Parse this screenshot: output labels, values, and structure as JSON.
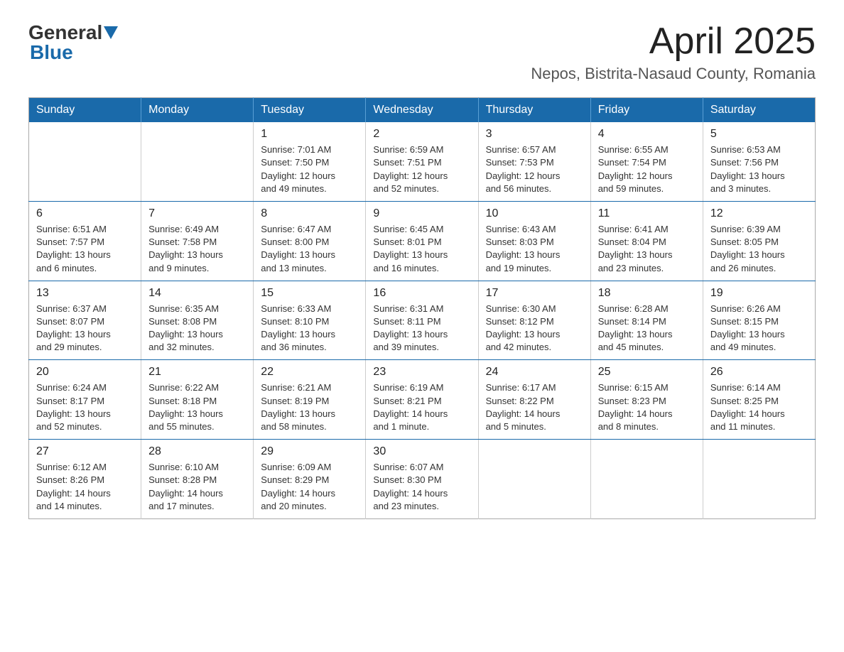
{
  "logo": {
    "general": "General",
    "blue": "Blue",
    "tagline": "Blue"
  },
  "header": {
    "month": "April 2025",
    "location": "Nepos, Bistrita-Nasaud County, Romania"
  },
  "weekdays": [
    "Sunday",
    "Monday",
    "Tuesday",
    "Wednesday",
    "Thursday",
    "Friday",
    "Saturday"
  ],
  "weeks": [
    [
      {
        "day": "",
        "info": ""
      },
      {
        "day": "",
        "info": ""
      },
      {
        "day": "1",
        "info": "Sunrise: 7:01 AM\nSunset: 7:50 PM\nDaylight: 12 hours\nand 49 minutes."
      },
      {
        "day": "2",
        "info": "Sunrise: 6:59 AM\nSunset: 7:51 PM\nDaylight: 12 hours\nand 52 minutes."
      },
      {
        "day": "3",
        "info": "Sunrise: 6:57 AM\nSunset: 7:53 PM\nDaylight: 12 hours\nand 56 minutes."
      },
      {
        "day": "4",
        "info": "Sunrise: 6:55 AM\nSunset: 7:54 PM\nDaylight: 12 hours\nand 59 minutes."
      },
      {
        "day": "5",
        "info": "Sunrise: 6:53 AM\nSunset: 7:56 PM\nDaylight: 13 hours\nand 3 minutes."
      }
    ],
    [
      {
        "day": "6",
        "info": "Sunrise: 6:51 AM\nSunset: 7:57 PM\nDaylight: 13 hours\nand 6 minutes."
      },
      {
        "day": "7",
        "info": "Sunrise: 6:49 AM\nSunset: 7:58 PM\nDaylight: 13 hours\nand 9 minutes."
      },
      {
        "day": "8",
        "info": "Sunrise: 6:47 AM\nSunset: 8:00 PM\nDaylight: 13 hours\nand 13 minutes."
      },
      {
        "day": "9",
        "info": "Sunrise: 6:45 AM\nSunset: 8:01 PM\nDaylight: 13 hours\nand 16 minutes."
      },
      {
        "day": "10",
        "info": "Sunrise: 6:43 AM\nSunset: 8:03 PM\nDaylight: 13 hours\nand 19 minutes."
      },
      {
        "day": "11",
        "info": "Sunrise: 6:41 AM\nSunset: 8:04 PM\nDaylight: 13 hours\nand 23 minutes."
      },
      {
        "day": "12",
        "info": "Sunrise: 6:39 AM\nSunset: 8:05 PM\nDaylight: 13 hours\nand 26 minutes."
      }
    ],
    [
      {
        "day": "13",
        "info": "Sunrise: 6:37 AM\nSunset: 8:07 PM\nDaylight: 13 hours\nand 29 minutes."
      },
      {
        "day": "14",
        "info": "Sunrise: 6:35 AM\nSunset: 8:08 PM\nDaylight: 13 hours\nand 32 minutes."
      },
      {
        "day": "15",
        "info": "Sunrise: 6:33 AM\nSunset: 8:10 PM\nDaylight: 13 hours\nand 36 minutes."
      },
      {
        "day": "16",
        "info": "Sunrise: 6:31 AM\nSunset: 8:11 PM\nDaylight: 13 hours\nand 39 minutes."
      },
      {
        "day": "17",
        "info": "Sunrise: 6:30 AM\nSunset: 8:12 PM\nDaylight: 13 hours\nand 42 minutes."
      },
      {
        "day": "18",
        "info": "Sunrise: 6:28 AM\nSunset: 8:14 PM\nDaylight: 13 hours\nand 45 minutes."
      },
      {
        "day": "19",
        "info": "Sunrise: 6:26 AM\nSunset: 8:15 PM\nDaylight: 13 hours\nand 49 minutes."
      }
    ],
    [
      {
        "day": "20",
        "info": "Sunrise: 6:24 AM\nSunset: 8:17 PM\nDaylight: 13 hours\nand 52 minutes."
      },
      {
        "day": "21",
        "info": "Sunrise: 6:22 AM\nSunset: 8:18 PM\nDaylight: 13 hours\nand 55 minutes."
      },
      {
        "day": "22",
        "info": "Sunrise: 6:21 AM\nSunset: 8:19 PM\nDaylight: 13 hours\nand 58 minutes."
      },
      {
        "day": "23",
        "info": "Sunrise: 6:19 AM\nSunset: 8:21 PM\nDaylight: 14 hours\nand 1 minute."
      },
      {
        "day": "24",
        "info": "Sunrise: 6:17 AM\nSunset: 8:22 PM\nDaylight: 14 hours\nand 5 minutes."
      },
      {
        "day": "25",
        "info": "Sunrise: 6:15 AM\nSunset: 8:23 PM\nDaylight: 14 hours\nand 8 minutes."
      },
      {
        "day": "26",
        "info": "Sunrise: 6:14 AM\nSunset: 8:25 PM\nDaylight: 14 hours\nand 11 minutes."
      }
    ],
    [
      {
        "day": "27",
        "info": "Sunrise: 6:12 AM\nSunset: 8:26 PM\nDaylight: 14 hours\nand 14 minutes."
      },
      {
        "day": "28",
        "info": "Sunrise: 6:10 AM\nSunset: 8:28 PM\nDaylight: 14 hours\nand 17 minutes."
      },
      {
        "day": "29",
        "info": "Sunrise: 6:09 AM\nSunset: 8:29 PM\nDaylight: 14 hours\nand 20 minutes."
      },
      {
        "day": "30",
        "info": "Sunrise: 6:07 AM\nSunset: 8:30 PM\nDaylight: 14 hours\nand 23 minutes."
      },
      {
        "day": "",
        "info": ""
      },
      {
        "day": "",
        "info": ""
      },
      {
        "day": "",
        "info": ""
      }
    ]
  ]
}
